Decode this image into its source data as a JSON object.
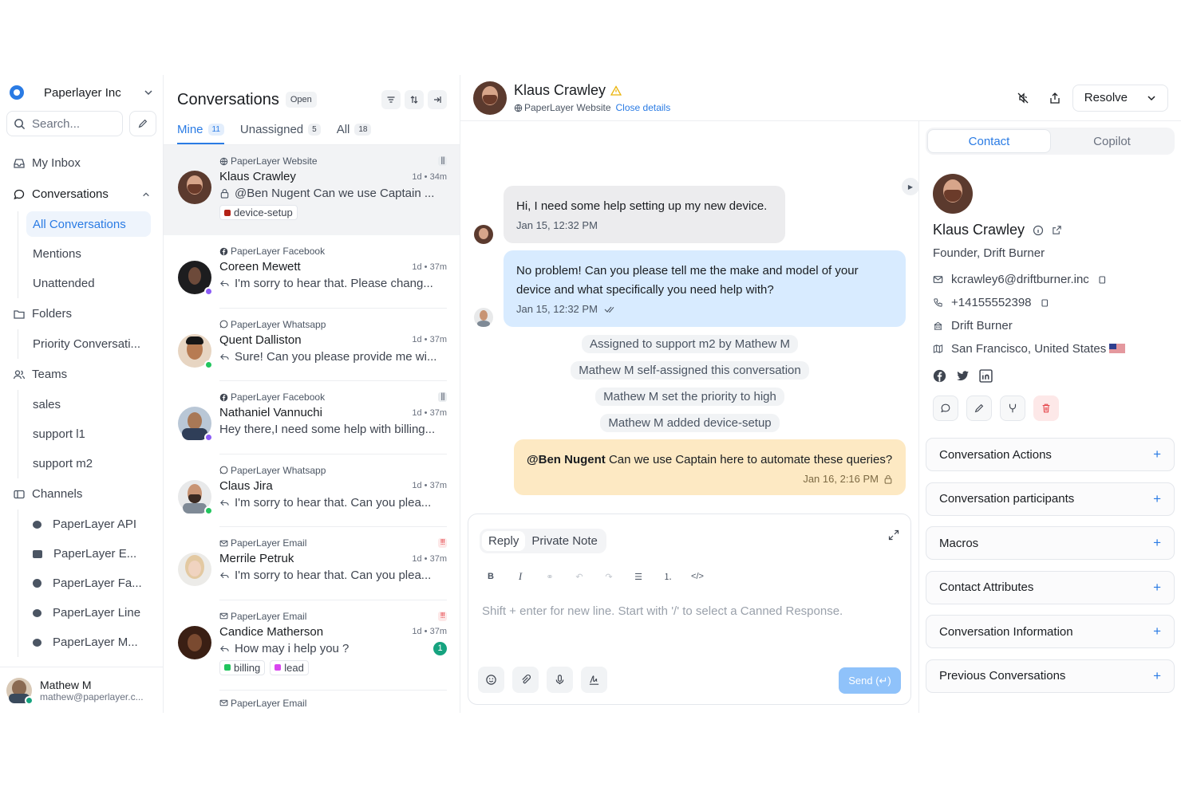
{
  "workspace": {
    "name": "Paperlayer Inc"
  },
  "search": {
    "placeholder": "Search..."
  },
  "nav": {
    "my_inbox": "My Inbox",
    "conversations": "Conversations",
    "conversation_views": [
      "All Conversations",
      "Mentions",
      "Unattended"
    ],
    "folders": "Folders",
    "folder_items": [
      "Priority Conversati..."
    ],
    "teams": "Teams",
    "team_items": [
      "sales",
      "support l1",
      "support m2"
    ],
    "channels": "Channels",
    "channel_items": [
      {
        "label": "PaperLayer API",
        "icon": "globe-icon"
      },
      {
        "label": "PaperLayer E...",
        "icon": "mail-icon"
      },
      {
        "label": "PaperLayer Fa...",
        "icon": "messenger-icon"
      },
      {
        "label": "PaperLayer Line",
        "icon": "line-icon"
      },
      {
        "label": "PaperLayer M...",
        "icon": "chat-icon"
      }
    ]
  },
  "current_user": {
    "name": "Mathew M",
    "email": "mathew@paperlayer.c..."
  },
  "list": {
    "title": "Conversations",
    "status": "Open",
    "tabs": [
      {
        "label": "Mine",
        "count": "11"
      },
      {
        "label": "Unassigned",
        "count": "5"
      },
      {
        "label": "All",
        "count": "18"
      }
    ],
    "items": [
      {
        "inbox": "PaperLayer Website",
        "inbox_icon": "globe-icon",
        "name": "Klaus Crawley",
        "time": "1d • 34m",
        "message": "@Ben Nugent Can we use Captain ...",
        "msg_icon": "lock-icon",
        "priority": "medium",
        "labels": [
          {
            "text": "device-setup",
            "color": "#b42318"
          }
        ]
      },
      {
        "inbox": "PaperLayer Facebook",
        "inbox_icon": "facebook-icon",
        "name": "Coreen Mewett",
        "time": "1d • 37m",
        "message": "I'm sorry to hear that. Please chang...",
        "msg_icon": "reply-icon"
      },
      {
        "inbox": "PaperLayer Whatsapp",
        "inbox_icon": "whatsapp-icon",
        "name": "Quent Dalliston",
        "time": "1d • 37m",
        "message": "Sure! Can you please provide me wi...",
        "msg_icon": "reply-icon"
      },
      {
        "inbox": "PaperLayer Facebook",
        "inbox_icon": "facebook-icon",
        "name": "Nathaniel Vannuchi",
        "time": "1d • 37m",
        "message": "Hey there,I need some help with billing...",
        "priority": "medium"
      },
      {
        "inbox": "PaperLayer Whatsapp",
        "inbox_icon": "whatsapp-icon",
        "name": "Claus Jira",
        "time": "1d • 37m",
        "message": "I'm sorry to hear that. Can you plea...",
        "msg_icon": "reply-icon"
      },
      {
        "inbox": "PaperLayer Email",
        "inbox_icon": "mail-icon",
        "name": "Merrile Petruk",
        "time": "1d • 37m",
        "message": "I'm sorry to hear that. Can you plea...",
        "msg_icon": "reply-icon",
        "priority": "urgent"
      },
      {
        "inbox": "PaperLayer Email",
        "inbox_icon": "mail-icon",
        "name": "Candice Matherson",
        "time": "1d • 37m",
        "message": "How may i help you ?",
        "msg_icon": "reply-icon",
        "priority": "urgent",
        "unread": "1",
        "labels": [
          {
            "text": "billing",
            "color": "#22c55e"
          },
          {
            "text": "lead",
            "color": "#d946ef"
          }
        ]
      },
      {
        "inbox": "PaperLayer Email",
        "inbox_icon": "mail-icon"
      }
    ]
  },
  "conversation": {
    "contact_name": "Klaus Crawley",
    "inbox": "PaperLayer Website",
    "close_details": "Close details",
    "resolve": "Resolve",
    "messages": [
      {
        "text": "Hi, I need some help setting up my new device.",
        "time": "Jan 15, 12:32 PM"
      },
      {
        "text": "No problem! Can you please tell me the make and model of your device and what specifically you need help with?",
        "time": "Jan 15, 12:32 PM"
      }
    ],
    "activities": [
      "Assigned to support m2 by Mathew M",
      "Mathew M self-assigned this conversation",
      "Mathew M set the priority to high",
      "Mathew M added device-setup"
    ],
    "note": {
      "mention": "@Ben Nugent",
      "text": " Can we use Captain here to automate these queries?",
      "time": "Jan 16, 2:16 PM"
    }
  },
  "editor": {
    "modes": [
      "Reply",
      "Private Note"
    ],
    "placeholder": "Shift + enter for new line. Start with '/' to select a Canned Response.",
    "send": "Send (↵)"
  },
  "panel": {
    "tabs": [
      "Contact",
      "Copilot"
    ],
    "contact": {
      "name": "Klaus Crawley",
      "role": "Founder, Drift Burner",
      "email": "kcrawley6@driftburner.inc",
      "phone": "+14155552398",
      "company": "Drift Burner",
      "location": "San Francisco, United States"
    },
    "sections": [
      "Conversation Actions",
      "Conversation participants",
      "Macros",
      "Contact Attributes",
      "Conversation Information",
      "Previous Conversations"
    ]
  },
  "colors": {
    "accent": "#2a7be4",
    "note_bg": "#fde9c3",
    "outgoing_bg": "#d8ebff"
  }
}
